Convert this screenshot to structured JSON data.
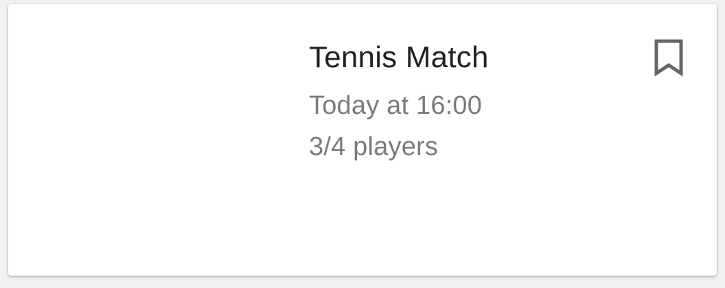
{
  "event": {
    "title": "Tennis Match",
    "time": "Today at 16:00",
    "players": "3/4 players"
  },
  "icons": {
    "bookmark": "bookmark-outline-icon"
  },
  "colors": {
    "title": "#212121",
    "secondary": "#7b7b7b",
    "icon": "#666666",
    "card": "#ffffff",
    "background": "#f1f1f1"
  }
}
